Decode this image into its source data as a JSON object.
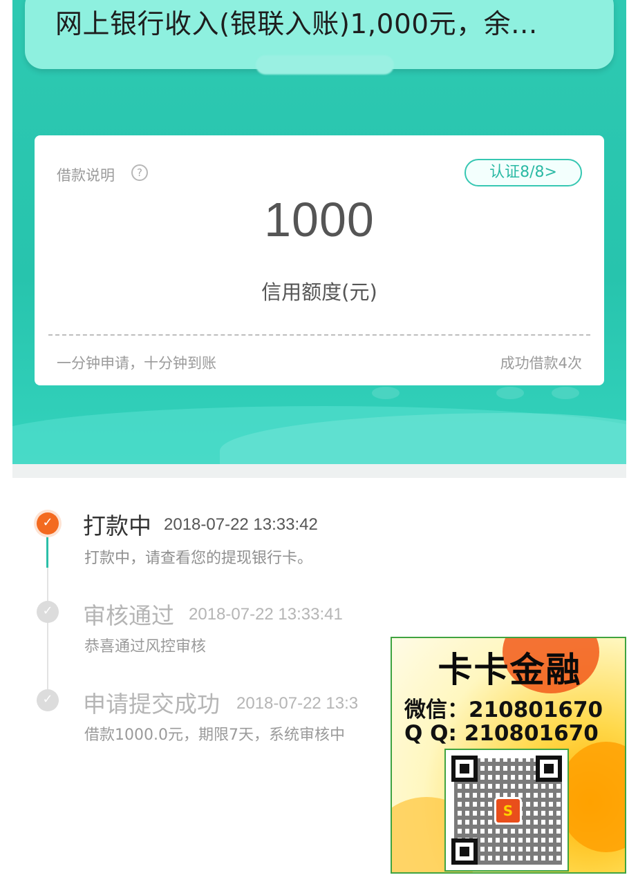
{
  "notice": {
    "text": "网上银行收入(银联入账)1,000元，余..."
  },
  "card": {
    "help_label": "借款说明",
    "help_icon": "?",
    "verify_button": "认证8/8>",
    "amount": "1000",
    "amount_label": "信用额度(元)",
    "footer_left": "一分钟申请，十分钟到账",
    "footer_right": "成功借款4次"
  },
  "timeline": {
    "steps": [
      {
        "title": "打款中",
        "time": "2018-07-22 13:33:42",
        "desc": "打款中，请查看您的提现银行卡。",
        "status": "active"
      },
      {
        "title": "审核通过",
        "time": "2018-07-22 13:33:41",
        "desc": "恭喜通过风控审核",
        "status": "done"
      },
      {
        "title": "申请提交成功",
        "time": "2018-07-22 13:3",
        "desc": "借款1000.0元，期限7天，系统审核中",
        "status": "done"
      }
    ]
  },
  "ad": {
    "title": "卡卡金融",
    "wechat": "微信：210801670",
    "qq": "Q  Q: 210801670",
    "qr_logo": "S"
  },
  "colors": {
    "teal": "#27c4ad",
    "active_orange": "#f36a1f",
    "ad_border": "#3fa340"
  }
}
